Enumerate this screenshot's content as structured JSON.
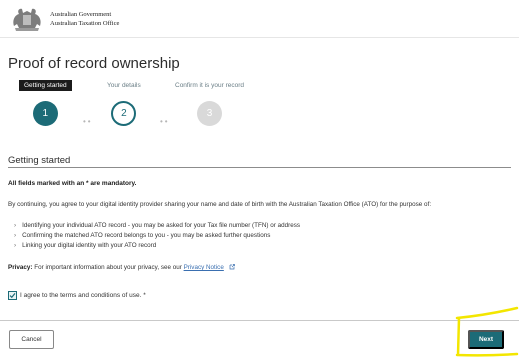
{
  "header": {
    "gov_line1": "Australian Government",
    "gov_line2": "Australian Taxation Office",
    "crest_icon": "coat-of-arms-icon"
  },
  "page_title": "Proof of record ownership",
  "steps": [
    {
      "label": "Getting started",
      "number": "1",
      "state": "active"
    },
    {
      "label": "Your details",
      "number": "2",
      "state": "next"
    },
    {
      "label": "Confirm it is your record",
      "number": "3",
      "state": "pending"
    }
  ],
  "step_connector": "••",
  "section": {
    "title": "Getting started",
    "mandatory_note": "All fields marked with an * are mandatory.",
    "consent_intro": "By continuing, you agree to your digital identity provider sharing your name and date of birth with the Australian Taxation Office (ATO) for the purpose of:",
    "consent_items": [
      "Identifying your individual ATO record - you may be asked for your Tax file number (TFN) or address",
      "Confirming the matched ATO record belongs to you - you may be asked further questions",
      "Linking your digital identity with your ATO record"
    ],
    "privacy_label": "Privacy:",
    "privacy_text": "For important information about your privacy, see our",
    "privacy_link": "Privacy Notice",
    "privacy_link_icon": "external-link-icon",
    "agree_label": "I agree to the terms and conditions of use. *",
    "agree_checked": true
  },
  "footer": {
    "cancel_label": "Cancel",
    "next_label": "Next"
  },
  "colors": {
    "accent": "#1c6b77",
    "highlight": "#f3e600"
  }
}
